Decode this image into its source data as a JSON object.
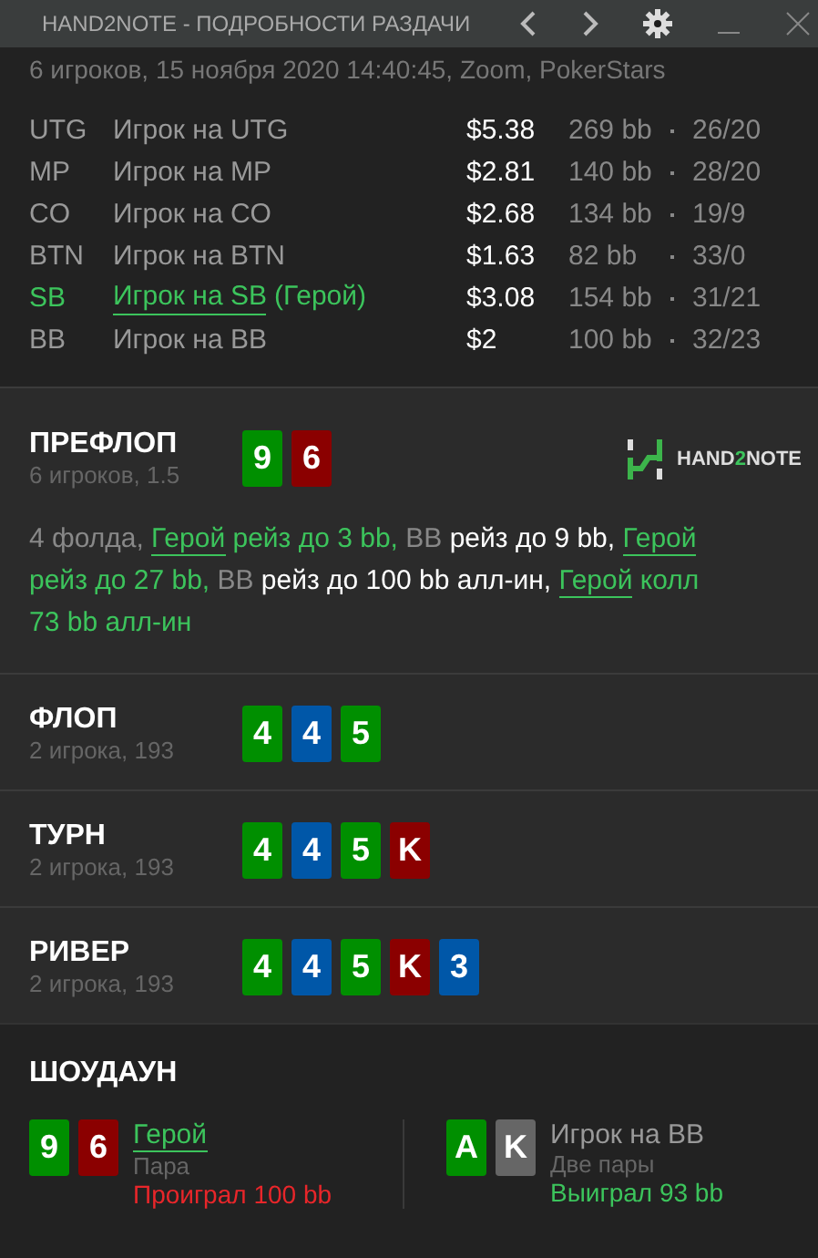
{
  "window": {
    "title": "HAND2NOTE - ПОДРОБНОСТИ РАЗДАЧИ"
  },
  "hand_info": "6 игроков, 15 ноября 2020 14:40:45, Zoom, PokerStars",
  "players": [
    {
      "position": "UTG",
      "name": "Игрок на UTG",
      "hero": false,
      "stack": "$5.38",
      "bb": "269 bb",
      "stats": "26/20"
    },
    {
      "position": "MP",
      "name": "Игрок на MP",
      "hero": false,
      "stack": "$2.81",
      "bb": "140 bb",
      "stats": "28/20"
    },
    {
      "position": "CO",
      "name": "Игрок на CO",
      "hero": false,
      "stack": "$2.68",
      "bb": "134 bb",
      "stats": "19/9"
    },
    {
      "position": "BTN",
      "name": "Игрок на BTN",
      "hero": false,
      "stack": "$1.63",
      "bb": "82 bb",
      "stats": "33/0"
    },
    {
      "position": "SB",
      "name": "Игрок на SB",
      "hero": true,
      "hero_tag": "(Герой)",
      "stack": "$3.08",
      "bb": "154 bb",
      "stats": "31/21"
    },
    {
      "position": "BB",
      "name": "Игрок на BB",
      "hero": false,
      "stack": "$2",
      "bb": "100 bb",
      "stats": "32/23"
    }
  ],
  "logo": {
    "prefix": "HAND",
    "accent": "2",
    "suffix": "NOTE"
  },
  "streets": [
    {
      "title": "ПРЕФЛОП",
      "subtitle": "6 игроков, 1.5",
      "cards": [
        {
          "rank": "9",
          "color": "#008f00"
        },
        {
          "rank": "6",
          "color": "#8b0000"
        }
      ],
      "actions": [
        {
          "text": "4 фолда, ",
          "kind": "muted"
        },
        {
          "text": "Герой",
          "kind": "hero-link"
        },
        {
          "text": " рейз до 3 bb, ",
          "kind": "hero"
        },
        {
          "text": "BB",
          "kind": "muted"
        },
        {
          "text": " рейз до 9 bb, ",
          "kind": "plain"
        },
        {
          "text": "Герой",
          "kind": "hero-link"
        },
        {
          "text": " рейз до 27 bb, ",
          "kind": "hero"
        },
        {
          "text": "BB",
          "kind": "muted"
        },
        {
          "text": " рейз до 100 bb алл-ин, ",
          "kind": "plain"
        },
        {
          "text": "Герой",
          "kind": "hero-link"
        },
        {
          "text": " колл 73 bb алл-ин",
          "kind": "hero"
        }
      ]
    },
    {
      "title": "ФЛОП",
      "subtitle": "2 игрока, 193",
      "cards": [
        {
          "rank": "4",
          "color": "#008f00"
        },
        {
          "rank": "4",
          "color": "#0057a8"
        },
        {
          "rank": "5",
          "color": "#008f00"
        }
      ]
    },
    {
      "title": "ТУРН",
      "subtitle": "2 игрока, 193",
      "cards": [
        {
          "rank": "4",
          "color": "#008f00"
        },
        {
          "rank": "4",
          "color": "#0057a8"
        },
        {
          "rank": "5",
          "color": "#008f00"
        },
        {
          "rank": "K",
          "color": "#8b0000"
        }
      ]
    },
    {
      "title": "РИВЕР",
      "subtitle": "2 игрока, 193",
      "cards": [
        {
          "rank": "4",
          "color": "#008f00"
        },
        {
          "rank": "4",
          "color": "#0057a8"
        },
        {
          "rank": "5",
          "color": "#008f00"
        },
        {
          "rank": "K",
          "color": "#8b0000"
        },
        {
          "rank": "3",
          "color": "#0057a8"
        }
      ]
    }
  ],
  "showdown": {
    "title": "ШОУДАУН",
    "players": [
      {
        "name": "Герой",
        "hero": true,
        "hand": "Пара",
        "result": "Проиграл 100 bb",
        "won": false,
        "cards": [
          {
            "rank": "9",
            "color": "#008f00"
          },
          {
            "rank": "6",
            "color": "#8b0000"
          }
        ]
      },
      {
        "name": "Игрок на BB",
        "hero": false,
        "hand": "Две пары",
        "result": "Выиграл 93 bb",
        "won": true,
        "cards": [
          {
            "rank": "A",
            "color": "#008f00"
          },
          {
            "rank": "K",
            "color": "#666666"
          }
        ]
      }
    ]
  }
}
